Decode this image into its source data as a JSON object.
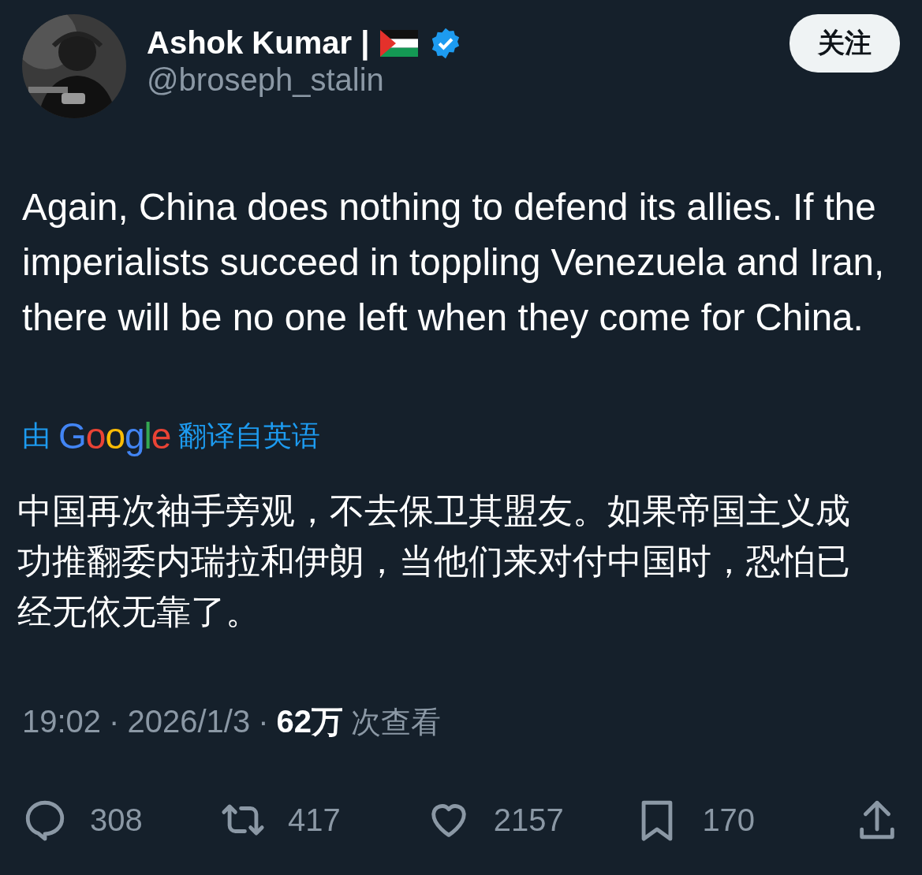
{
  "author": {
    "name": "Ashok Kumar |",
    "handle": "@broseph_stalin",
    "verified": true
  },
  "follow_button": {
    "label": "关注"
  },
  "tweet_text": "Again, China does nothing to defend its allies. If the imperialists succeed in toppling Venezuela and Iran, there will be no one left when they come for China.",
  "translation": {
    "prefix": "由",
    "brand": "Google",
    "suffix": "翻译自英语",
    "text": "中国再次袖手旁观，不去保卫其盟友。如果帝国主义成功推翻委内瑞拉和伊朗，当他们来对付中国时，恐怕已经无依无靠了。"
  },
  "meta": {
    "separator": "·",
    "time": "19:02",
    "date": "2026/1/3",
    "views": "62万",
    "views_label": "次查看"
  },
  "actions": [
    {
      "kind": "reply",
      "count": "308"
    },
    {
      "kind": "repost",
      "count": "417"
    },
    {
      "kind": "like",
      "count": "2157"
    },
    {
      "kind": "bookmark",
      "count": "170"
    },
    {
      "kind": "share"
    }
  ]
}
